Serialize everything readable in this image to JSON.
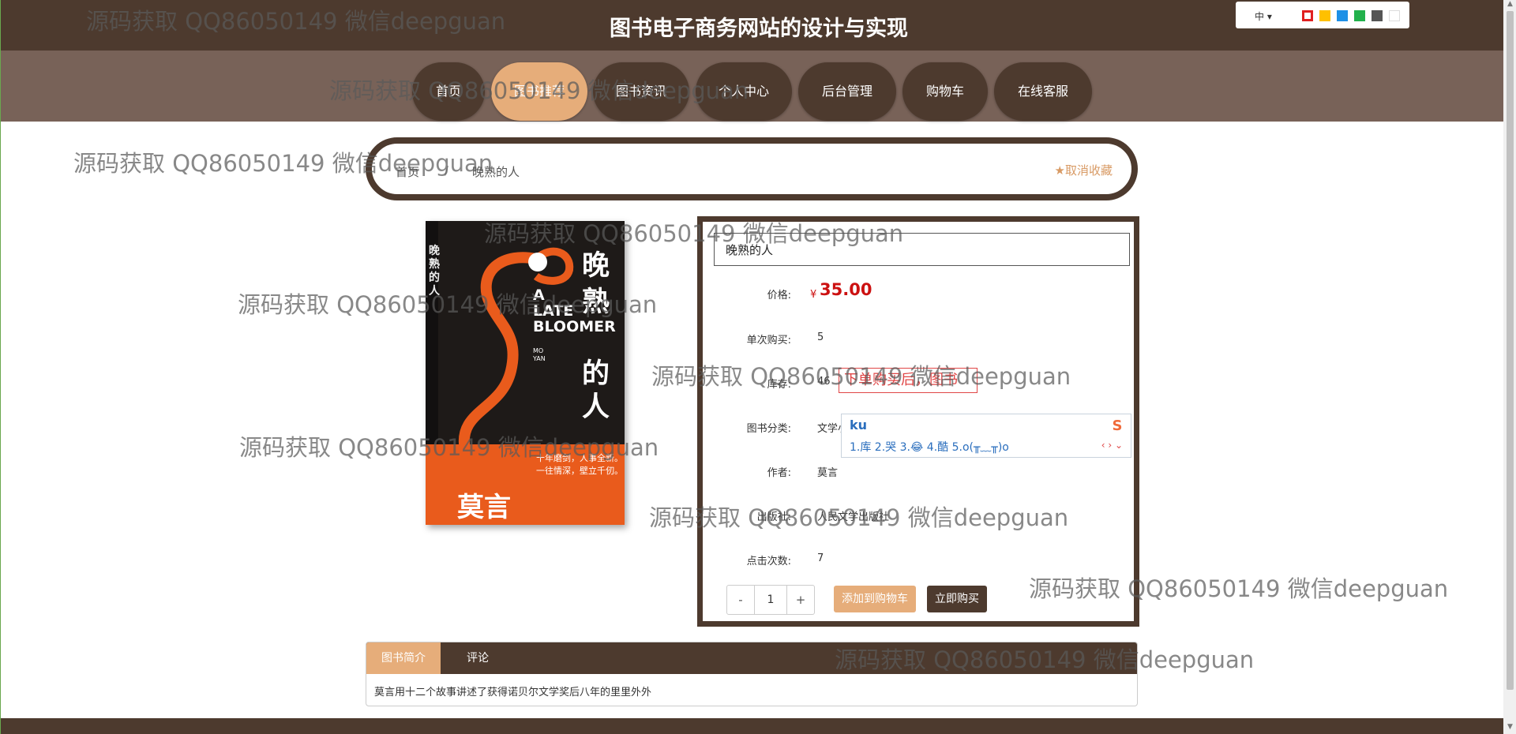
{
  "header": {
    "title": "图书电子商务网站的设计与实现"
  },
  "language": {
    "selected": "中",
    "swatches": [
      "#ffffff",
      "#ffc000",
      "#1e90e6",
      "#22b14c",
      "#555555",
      "#ffffff"
    ]
  },
  "nav": {
    "items": [
      {
        "label": "首页"
      },
      {
        "label": "图书推荐"
      },
      {
        "label": "图书资讯"
      },
      {
        "label": "个人中心"
      },
      {
        "label": "后台管理"
      },
      {
        "label": "购物车"
      },
      {
        "label": "在线客服"
      }
    ],
    "active_index": 1
  },
  "breadcrumb": {
    "home": "首页",
    "separator": "/",
    "current": "晚熟的人",
    "favorite_label": "取消收藏"
  },
  "cover": {
    "title_cn": "晚熟的人",
    "title_big_1": "晚",
    "title_big_2": "熟",
    "title_big_3": "的",
    "title_big_4": "人",
    "en_line1": "A",
    "en_line2": "LATE",
    "en_line3": "BLOOMER",
    "author_en_1": "MO",
    "author_en_2": "YAN",
    "author_cn": "莫言",
    "tagline_1": "十年磨剑，人事全新。",
    "tagline_2": "一往情深，壁立千仞。"
  },
  "book": {
    "title": "晚熟的人",
    "price_symbol": "¥",
    "price": "35.00",
    "fields": [
      {
        "label": "价格:"
      },
      {
        "label": "单次购买:",
        "value": "5"
      },
      {
        "label": "库存:",
        "value": "46"
      },
      {
        "label": "图书分类:",
        "value": "文学小说"
      },
      {
        "label": "作者:",
        "value": "莫言"
      },
      {
        "label": "出版社:",
        "value": "人民文学出版社"
      },
      {
        "label": "点击次数:",
        "value": "7"
      }
    ]
  },
  "purchase": {
    "minus": "-",
    "quantity": "1",
    "plus": "+",
    "add_to_cart": "添加到购物车",
    "buy_now": "立即购买"
  },
  "ime": {
    "tip": "下单购买后，图书",
    "input": "ku",
    "candidates": "1.库  2.哭  3.😂  4.酷  5.o(╥﹏╥)o",
    "nav": "‹ › ⌄",
    "logo": "S"
  },
  "tabs": {
    "items": [
      {
        "label": "图书简介"
      },
      {
        "label": "评论"
      }
    ],
    "content": "莫言用十二个故事讲述了获得诺贝尔文学奖后八年的里里外外"
  },
  "watermark": "源码获取 QQ86050149 微信deepguan"
}
